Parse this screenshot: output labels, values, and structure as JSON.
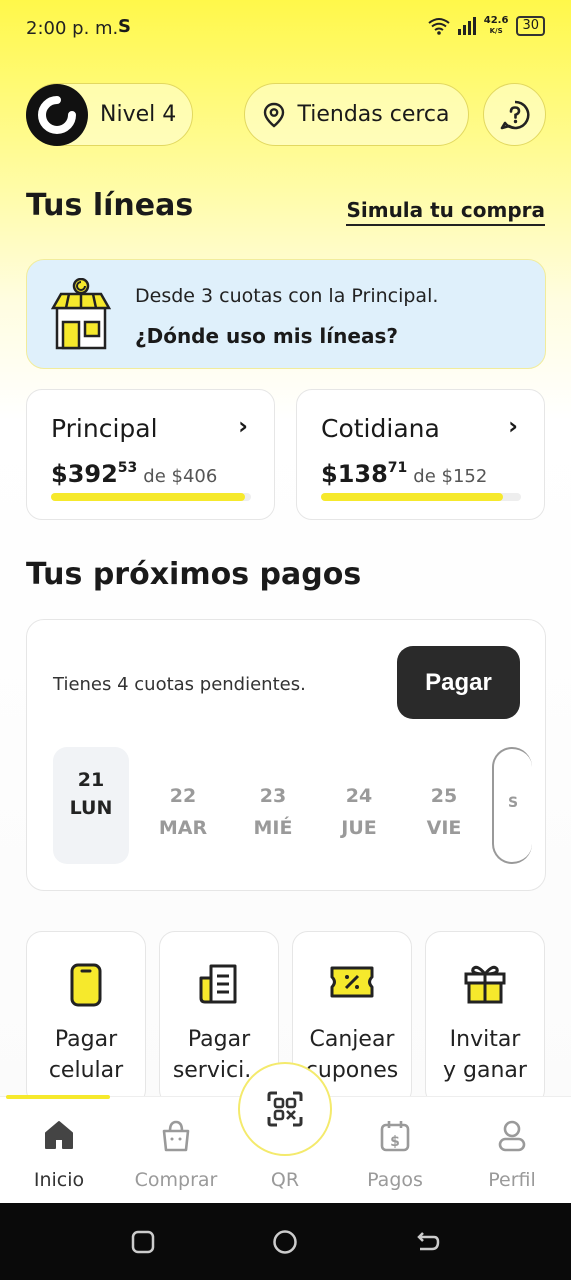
{
  "status": {
    "time": "2:00 p. m.",
    "app_glyph": "S",
    "speed_value": "42.6",
    "speed_unit": "K/S",
    "battery": "30"
  },
  "header": {
    "level_label": "Nivel 4",
    "stores_label": "Tiendas cerca",
    "help_icon": "help-icon"
  },
  "lines_section": {
    "title": "Tus líneas",
    "simula_link": "Simula tu compra",
    "banner": {
      "text": "Desde 3 cuotas con la Principal.",
      "link": "¿Dónde uso mis líneas?"
    },
    "cards": [
      {
        "name": "Principal",
        "amount_int": "$392",
        "amount_dec": "53",
        "of_label": "de $406",
        "progress": 0.97
      },
      {
        "name": "Cotidiana",
        "amount_int": "$138",
        "amount_dec": "71",
        "of_label": "de $152",
        "progress": 0.91
      }
    ]
  },
  "payments": {
    "title": "Tus próximos pagos",
    "pending_text": "Tienes 4 cuotas pendientes.",
    "pay_button": "Pagar",
    "days": [
      {
        "num": "21",
        "wd": "LUN",
        "selected": true
      },
      {
        "num": "22",
        "wd": "MAR"
      },
      {
        "num": "23",
        "wd": "MIÉ"
      },
      {
        "num": "24",
        "wd": "JUE"
      },
      {
        "num": "25",
        "wd": "VIE"
      }
    ],
    "more_day_glyph": "S"
  },
  "quick_actions": [
    {
      "line1": "Pagar",
      "line2": "celular",
      "icon": "phone-icon"
    },
    {
      "line1": "Pagar",
      "line2": "servici...",
      "icon": "receipt-icon"
    },
    {
      "line1": "Canjear",
      "line2": "cupones",
      "icon": "coupon-icon"
    },
    {
      "line1": "Invitar",
      "line2": "y ganar",
      "icon": "gift-icon"
    }
  ],
  "bottom_nav": [
    {
      "label": "Inicio",
      "icon": "home-icon",
      "active": true
    },
    {
      "label": "Comprar",
      "icon": "shopping-bag-icon"
    },
    {
      "label": "QR",
      "icon": "qr-icon"
    },
    {
      "label": "Pagos",
      "icon": "calendar-dollar-icon"
    },
    {
      "label": "Perfil",
      "icon": "user-icon"
    }
  ],
  "colors": {
    "accent_yellow": "#f6e92c",
    "dark_button": "#2a2a2a",
    "banner_blue": "#dff0fb"
  }
}
